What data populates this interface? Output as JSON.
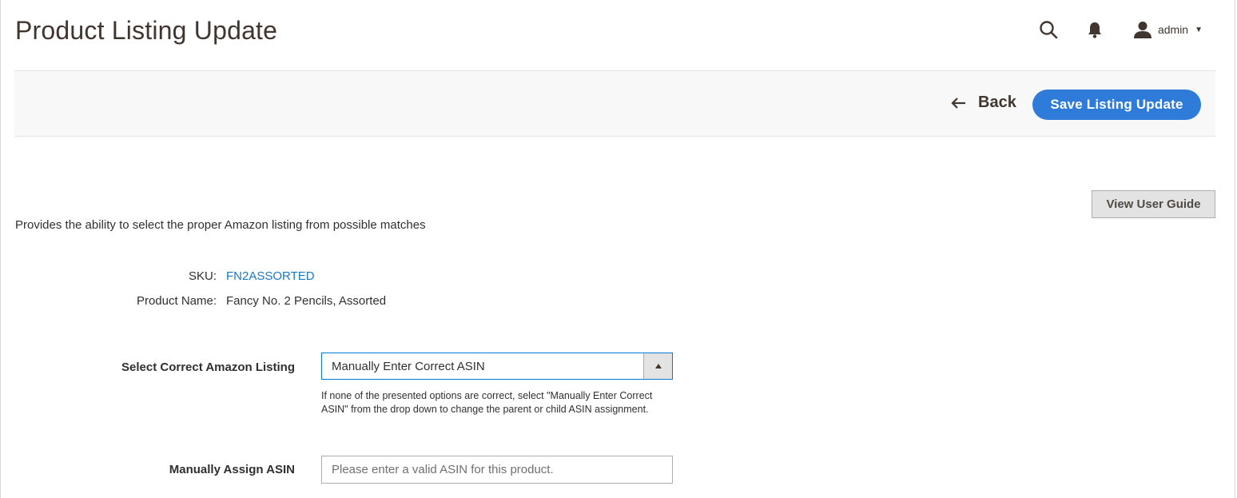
{
  "header": {
    "title": "Product Listing Update",
    "user": "admin",
    "icons": [
      "search-icon",
      "bell-icon",
      "user-icon",
      "chevron-down-icon"
    ]
  },
  "toolbar": {
    "back_label": "Back",
    "save_label": "Save Listing Update"
  },
  "guide_button": "View User Guide",
  "intro": "Provides the ability to select the proper Amazon listing from possible matches",
  "details": {
    "sku_label": "SKU:",
    "sku_value": "FN2ASSORTED",
    "product_name_label": "Product Name:",
    "product_name_value": "Fancy No. 2 Pencils, Assorted"
  },
  "form": {
    "select_label": "Select Correct Amazon Listing",
    "select_value": "Manually Enter Correct ASIN",
    "select_note": "If none of the presented options are correct, select \"Manually Enter Correct ASIN\" from the drop down to change the parent or child ASIN assignment.",
    "asin_label": "Manually Assign ASIN",
    "asin_placeholder": "Please enter a valid ASIN for this product.",
    "asin_value": ""
  },
  "colors": {
    "primary": "#2f7bd9",
    "link": "#1979c3",
    "title": "#41362f"
  }
}
